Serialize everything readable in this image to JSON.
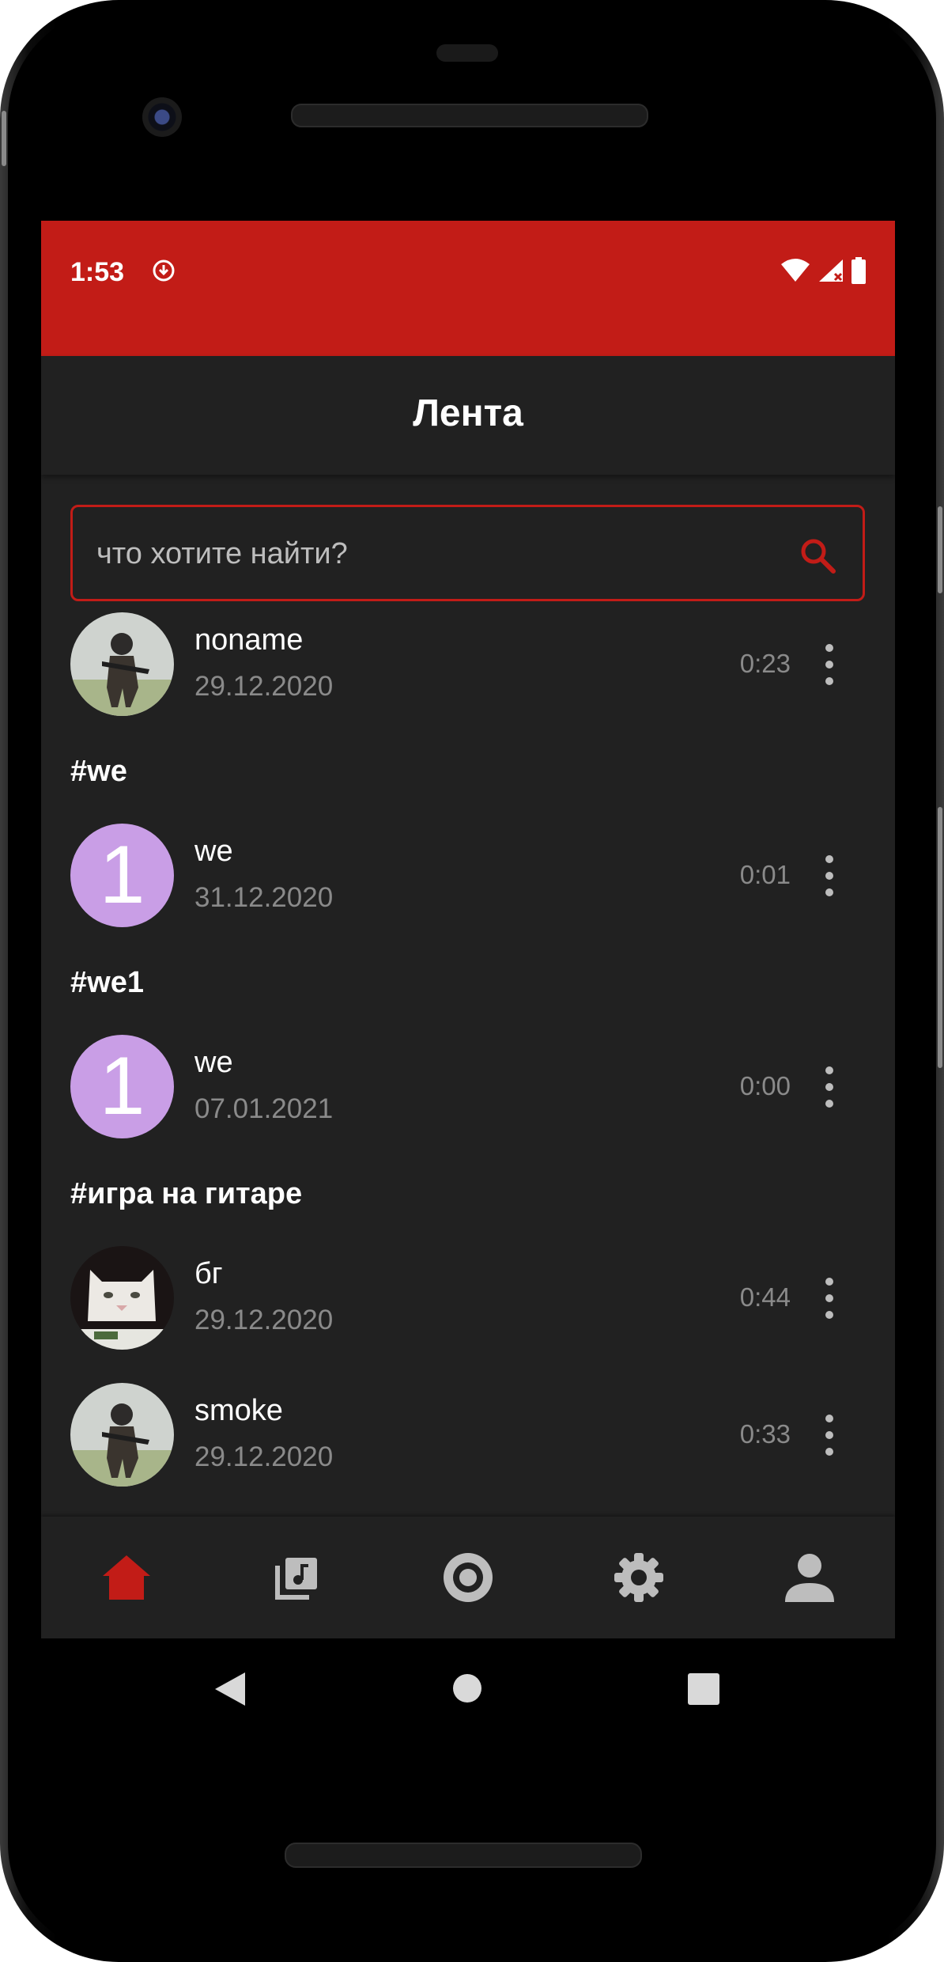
{
  "status_bar": {
    "time": "1:53",
    "background_color": "#c21c17",
    "icons": [
      "download-icon",
      "wifi-icon",
      "signal-icon",
      "battery-icon"
    ]
  },
  "app_bar": {
    "title": "Лента"
  },
  "search": {
    "placeholder": "что хотите найти?",
    "value": "",
    "border_color": "#c21c17"
  },
  "feed": {
    "sections": [
      {
        "heading": "",
        "items": [
          {
            "title": "noname",
            "date": "29.12.2020",
            "duration": "0:23",
            "avatar": "soldier-photo"
          }
        ]
      },
      {
        "heading": "#we",
        "items": [
          {
            "title": "we",
            "date": "31.12.2020",
            "duration": "0:01",
            "avatar_letter": "1"
          }
        ]
      },
      {
        "heading": "#we1",
        "items": [
          {
            "title": "we",
            "date": "07.01.2021",
            "duration": "0:00",
            "avatar_letter": "1"
          }
        ]
      },
      {
        "heading": "#игра на гитаре",
        "items": [
          {
            "title": "бг",
            "date": "29.12.2020",
            "duration": "0:44",
            "avatar": "cat-photo"
          },
          {
            "title": "smoke",
            "date": "29.12.2020",
            "duration": "0:33",
            "avatar": "soldier-photo"
          }
        ]
      }
    ]
  },
  "bottom_nav": {
    "items": [
      {
        "icon": "home-icon",
        "active": true
      },
      {
        "icon": "music-library-icon",
        "active": false
      },
      {
        "icon": "record-icon",
        "active": false
      },
      {
        "icon": "settings-icon",
        "active": false
      },
      {
        "icon": "profile-icon",
        "active": false
      }
    ],
    "active_color": "#c21c17",
    "inactive_color": "#bdbdbd"
  },
  "system_nav": {
    "icons": [
      "back-icon",
      "home-circle-icon",
      "recents-icon"
    ]
  },
  "colors": {
    "background": "#212121",
    "accent": "#c21c17",
    "avatar_letter_bg": "#c99ee6"
  }
}
